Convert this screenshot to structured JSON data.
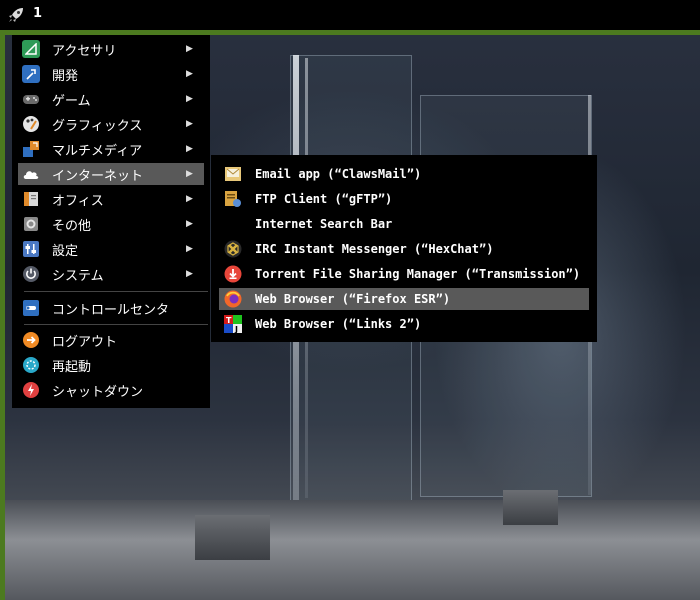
{
  "panel": {
    "workspace": "1",
    "launcher_icon": "rocket-icon"
  },
  "main_menu": {
    "items": [
      {
        "label": "アクセサリ",
        "icon": "accessories-icon",
        "color": "#2e9a57",
        "has_submenu": true
      },
      {
        "label": "開発",
        "icon": "development-icon",
        "color": "#2f6fc0",
        "has_submenu": true
      },
      {
        "label": "ゲーム",
        "icon": "gamepad-icon",
        "color": "#555555",
        "has_submenu": true
      },
      {
        "label": "グラフィックス",
        "icon": "graphics-icon",
        "color": "#e0e0e0",
        "has_submenu": true
      },
      {
        "label": "マルチメディア",
        "icon": "multimedia-icon",
        "color": "#e08a2a",
        "has_submenu": true
      },
      {
        "label": "インターネット",
        "icon": "cloud-icon",
        "color": "#ffffff",
        "has_submenu": true,
        "selected": true
      },
      {
        "label": "オフィス",
        "icon": "office-icon",
        "color": "#d9d9d9",
        "has_submenu": true
      },
      {
        "label": "その他",
        "icon": "other-icon",
        "color": "#9a9a9a",
        "has_submenu": true
      },
      {
        "label": "設定",
        "icon": "settings-icon",
        "color": "#4a78c2",
        "has_submenu": true
      },
      {
        "label": "システム",
        "icon": "power-icon",
        "color": "#555a66",
        "has_submenu": true
      }
    ],
    "control_center": {
      "label": "コントロールセンタ",
      "icon": "control-center-icon",
      "color": "#2f6fc0"
    },
    "session": [
      {
        "label": "ログアウト",
        "icon": "logout-icon",
        "color": "#f08a24"
      },
      {
        "label": "再起動",
        "icon": "restart-icon",
        "color": "#29a8c9"
      },
      {
        "label": "シャットダウン",
        "icon": "shutdown-icon",
        "color": "#e04040"
      }
    ]
  },
  "sub_menu": {
    "items": [
      {
        "label": "Email app (“ClawsMail”)",
        "icon": "mail-icon",
        "color": "#e8c87a"
      },
      {
        "label": "FTP Client (“gFTP”)",
        "icon": "ftp-icon",
        "color": "#d9a441"
      },
      {
        "label": "Internet Search Bar",
        "icon": "",
        "color": ""
      },
      {
        "label": "IRC Instant Messenger (“HexChat”)",
        "icon": "hexchat-icon",
        "color": "#d9b341"
      },
      {
        "label": "Torrent File Sharing Manager (“Transmission”)",
        "icon": "transmission-icon",
        "color": "#e8463a"
      },
      {
        "label": "Web Browser (“Firefox ESR”)",
        "icon": "firefox-icon",
        "color": "#f2672a",
        "selected": true
      },
      {
        "label": "Web Browser (“Links 2”)",
        "icon": "links-icon",
        "color": "#1a4cc9"
      }
    ]
  }
}
